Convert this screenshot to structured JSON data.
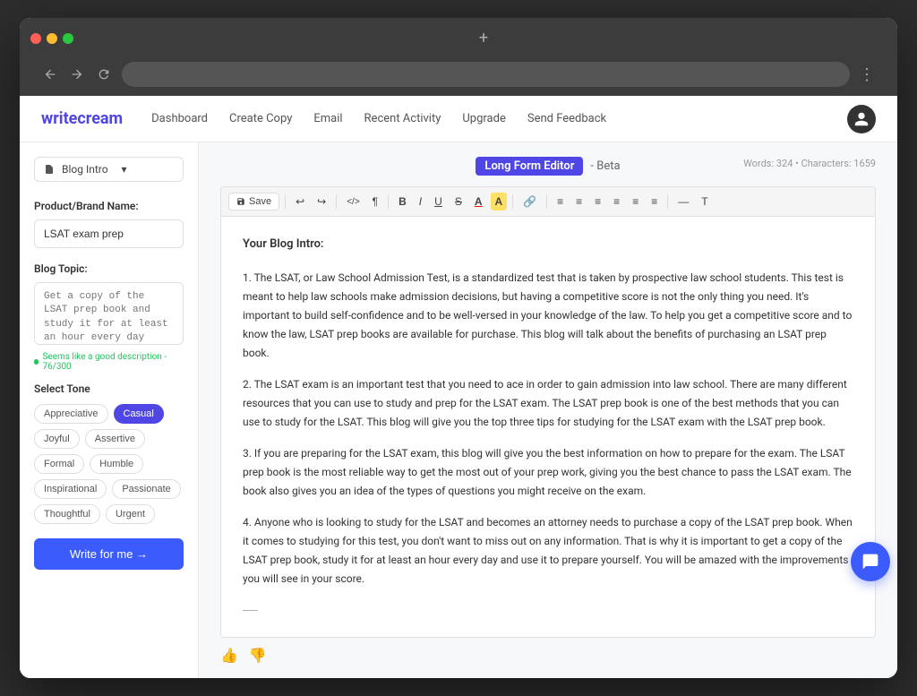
{
  "browser": {
    "new_tab_label": "+",
    "menu_label": "⋮"
  },
  "nav": {
    "logo_prefix": "write",
    "logo_suffix": "cream",
    "links": [
      {
        "label": "Dashboard"
      },
      {
        "label": "Create Copy"
      },
      {
        "label": "Email"
      },
      {
        "label": "Recent Activity"
      },
      {
        "label": "Upgrade"
      },
      {
        "label": "Send Feedback"
      }
    ],
    "user_initial": "👤"
  },
  "sidebar": {
    "dropdown_label": "Blog Intro",
    "product_label": "Product/Brand Name:",
    "product_value": "LSAT exam prep",
    "topic_label": "Blog Topic:",
    "topic_placeholder": "Get a copy of the LSAT prep book and study it for at least an hour every day",
    "char_count_label": "Seems like a good description - 76/300",
    "tone_label": "Select Tone",
    "tones": [
      {
        "label": "Appreciative",
        "active": false
      },
      {
        "label": "Casual",
        "active": true
      },
      {
        "label": "Joyful",
        "active": false
      },
      {
        "label": "Assertive",
        "active": false
      },
      {
        "label": "Formal",
        "active": false
      },
      {
        "label": "Humble",
        "active": false
      },
      {
        "label": "Inspirational",
        "active": false
      },
      {
        "label": "Passionate",
        "active": false
      },
      {
        "label": "Thoughtful",
        "active": false
      },
      {
        "label": "Urgent",
        "active": false
      }
    ],
    "write_btn_label": "Write for me →"
  },
  "editor": {
    "badge_label": "Long Form Editor",
    "subtitle": "- Beta",
    "word_count": "Words: 324 • Characters: 1659",
    "blog_title": "Your Blog Intro:",
    "paragraphs": [
      "1.  The LSAT, or Law School Admission Test, is a standardized test that is taken by prospective law school students. This test is meant to help law schools make admission decisions, but having a competitive score is not the only thing you need. It's important to build self-confidence and to be well-versed in your knowledge of the law. To help you get a competitive score and to know the law, LSAT prep books are available for purchase. This blog will talk about the benefits of purchasing an LSAT prep book.",
      "2.  The LSAT exam is an important test that you need to ace in order to gain admission into law school. There are many different resources that you can use to study and prep for the LSAT exam. The LSAT prep book is one of the best methods that you can use to study for the LSAT. This blog will give you the top three tips for studying for the LSAT exam with the LSAT prep book.",
      "3.  If you are preparing for the LSAT exam, this blog will give you the best information on how to prepare for the exam. The LSAT prep book is the most reliable way to get the most out of your prep work, giving you the best chance to pass the LSAT exam. The book also gives you an idea of the types of questions you might receive on the exam.",
      "4.  Anyone who is looking to study for the LSAT and becomes an attorney needs to purchase a copy of the LSAT prep book. When it comes to studying for this test, you don't want to miss out on any information. That is why it is important to get a copy of the LSAT prep book, study it for at least an hour every day and use it to prepare yourself. You will be amazed with the improvements you will see in your score."
    ],
    "divider": "-----"
  },
  "toolbar": {
    "save_label": "Save",
    "buttons": [
      "↩",
      "↪",
      "</>",
      "¶",
      "B",
      "I",
      "U",
      "S",
      "A",
      "A",
      "🔗",
      "≡",
      "≡",
      "≡",
      "≡",
      "≡",
      "≡",
      "—",
      "T"
    ]
  }
}
